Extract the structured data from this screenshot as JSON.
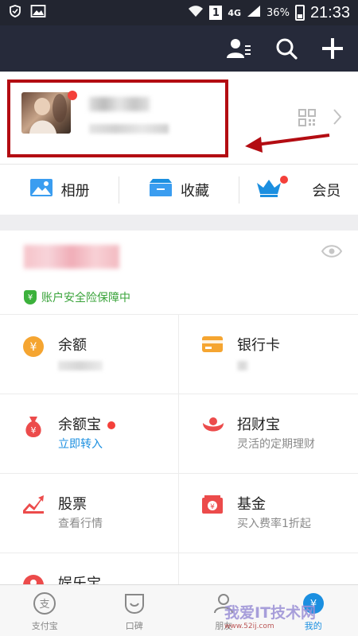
{
  "status_bar": {
    "network": "4G",
    "sim_slot": "1",
    "battery": "36%",
    "time": "21:33"
  },
  "top_bar": {
    "icons": [
      "contacts-icon",
      "search-icon",
      "add-icon"
    ]
  },
  "quick_actions": [
    {
      "label": "相册",
      "icon": "album-icon"
    },
    {
      "label": "收藏",
      "icon": "favorites-icon"
    },
    {
      "label": "会员",
      "icon": "crown-icon"
    }
  ],
  "account": {
    "safety_label": "账户安全险保障中"
  },
  "grid": [
    {
      "title": "余额",
      "subtitle": "",
      "icon": "balance-icon",
      "color": "#f5a531"
    },
    {
      "title": "银行卡",
      "subtitle": "",
      "icon": "bank-card-icon",
      "color": "#f5a531"
    },
    {
      "title": "余额宝",
      "subtitle": "立即转入",
      "icon": "money-bag-icon",
      "color": "#ec4b4b"
    },
    {
      "title": "招财宝",
      "subtitle": "灵活的定期理财",
      "icon": "zhaocaibao-icon",
      "color": "#ec4b4b"
    },
    {
      "title": "股票",
      "subtitle": "查看行情",
      "icon": "stock-icon",
      "color": "#ec4b4b"
    },
    {
      "title": "基金",
      "subtitle": "买入费率1折起",
      "icon": "fund-icon",
      "color": "#ec4b4b"
    },
    {
      "title": "娱乐宝",
      "subtitle": "",
      "icon": "entertainment-icon",
      "color": "#ec4b4b"
    }
  ],
  "tab_bar": [
    {
      "label": "支付宝",
      "icon": "alipay-icon"
    },
    {
      "label": "口碑",
      "icon": "koubei-icon"
    },
    {
      "label": "朋友",
      "icon": "friends-icon"
    },
    {
      "label": "我的",
      "icon": "me-icon"
    }
  ],
  "watermark": {
    "text": "我爱IT技术网",
    "sub": "www.52ij.com"
  },
  "colors": {
    "accent": "#1b8fe0",
    "header": "#262a3a",
    "alert": "#f4403a",
    "highlight": "#b30c12"
  }
}
